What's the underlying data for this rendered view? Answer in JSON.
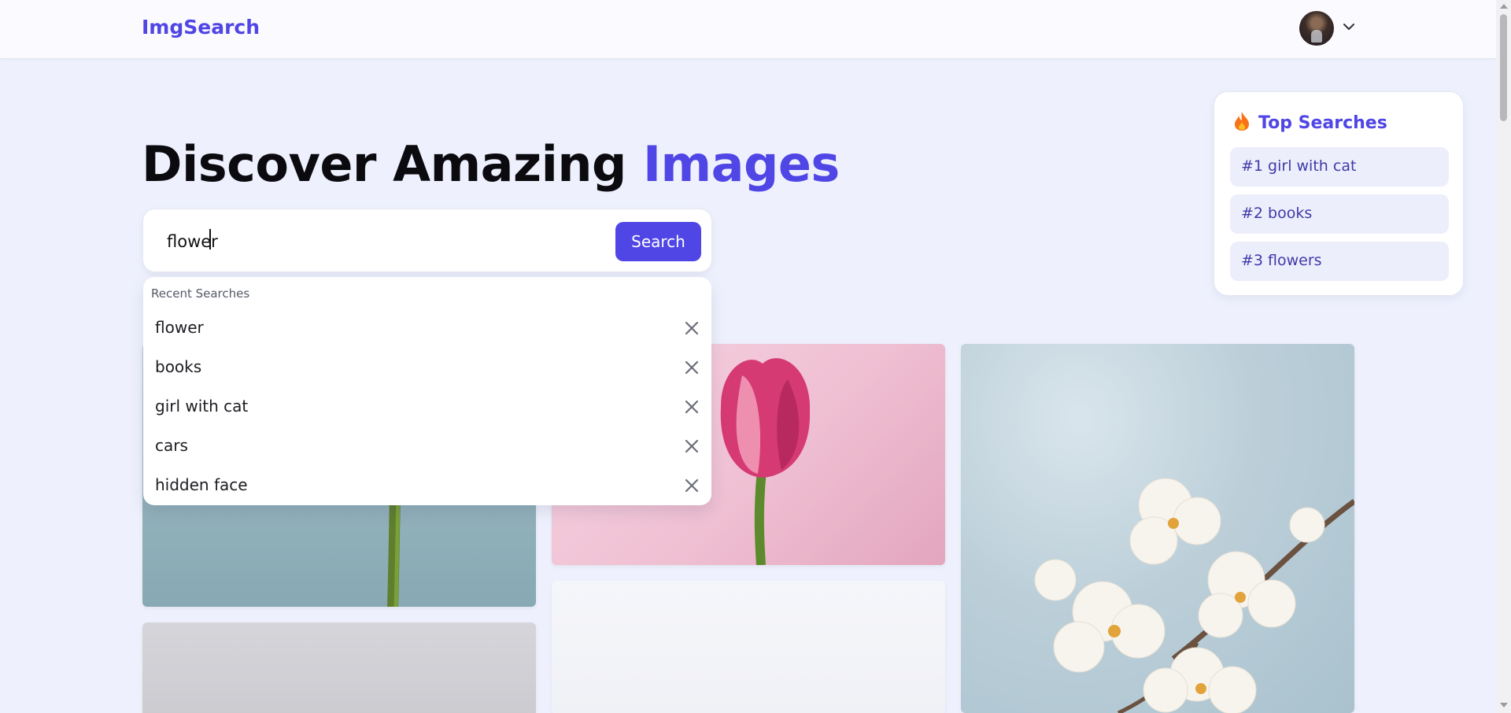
{
  "header": {
    "logo": "ImgSearch",
    "avatar_icon": "user-avatar",
    "menu_icon": "chevron-down-icon"
  },
  "hero": {
    "title_main": "Discover Amazing ",
    "title_accent": "Images"
  },
  "search": {
    "value": "flower",
    "button_label": "Search"
  },
  "recent": {
    "heading": "Recent Searches",
    "items": [
      "flower",
      "books",
      "girl with cat",
      "cars",
      "hidden face"
    ],
    "remove_icon": "close-icon"
  },
  "top_searches": {
    "icon": "fire-icon",
    "heading": "Top Searches",
    "items": [
      "#1 girl with cat",
      "#2 books",
      "#3 flowers"
    ]
  },
  "results": {
    "images": [
      "flower-stem",
      "pink-tulip",
      "white-blossoms",
      "gray-image",
      "white-image"
    ]
  },
  "colors": {
    "accent": "#4f46e5",
    "background": "#eef1fd",
    "chip_background": "#eceefc"
  }
}
